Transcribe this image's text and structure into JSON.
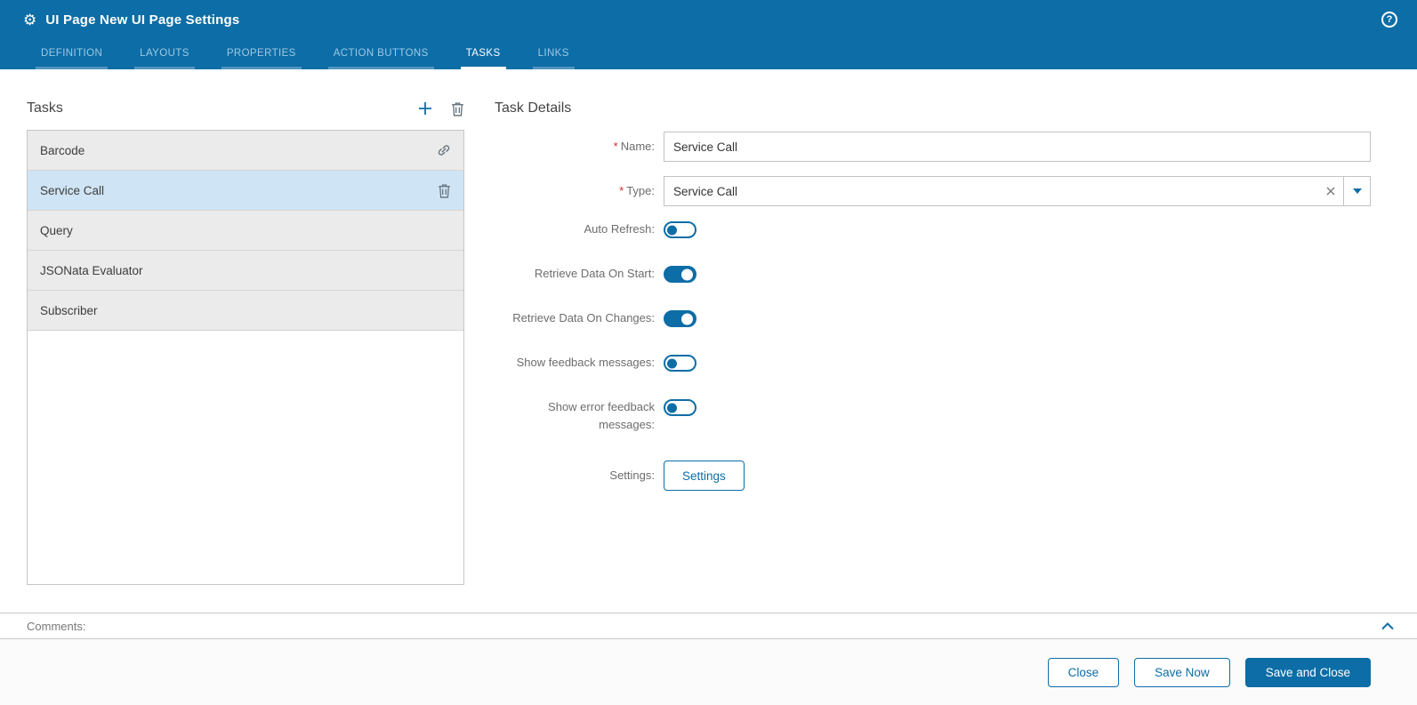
{
  "icons": {
    "gear": "⚙",
    "help": "?"
  },
  "header": {
    "title": "UI Page New UI Page Settings",
    "tabs": [
      {
        "label": "DEFINITION",
        "active": false
      },
      {
        "label": "LAYOUTS",
        "active": false
      },
      {
        "label": "PROPERTIES",
        "active": false
      },
      {
        "label": "ACTION BUTTONS",
        "active": false
      },
      {
        "label": "TASKS",
        "active": true
      },
      {
        "label": "LINKS",
        "active": false
      }
    ]
  },
  "tasks_panel": {
    "title": "Tasks",
    "items": [
      {
        "label": "Barcode",
        "selected": false
      },
      {
        "label": "Service Call",
        "selected": true
      },
      {
        "label": "Query",
        "selected": false
      },
      {
        "label": "JSONata Evaluator",
        "selected": false
      },
      {
        "label": "Subscriber",
        "selected": false
      }
    ]
  },
  "task_details": {
    "title": "Task Details",
    "required_marker": "*",
    "name": {
      "label": "Name:",
      "value": "Service Call"
    },
    "type": {
      "label": "Type:",
      "value": "Service Call"
    },
    "auto_refresh": {
      "label": "Auto Refresh:",
      "on": false
    },
    "retrieve_on_start": {
      "label": "Retrieve Data On Start:",
      "on": true
    },
    "retrieve_on_changes": {
      "label": "Retrieve Data On Changes:",
      "on": true
    },
    "show_feedback": {
      "label": "Show feedback messages:",
      "on": false
    },
    "show_error_feedback": {
      "label": "Show error feedback messages:",
      "on": false
    },
    "settings": {
      "label": "Settings:",
      "button_label": "Settings"
    }
  },
  "comments": {
    "label": "Comments:"
  },
  "footer": {
    "close_label": "Close",
    "save_now_label": "Save Now",
    "save_and_close_label": "Save and Close"
  },
  "colors": {
    "accent": "#0d6da6",
    "topbar": "#0d6da6",
    "selected_row": "#cfe4f4"
  }
}
